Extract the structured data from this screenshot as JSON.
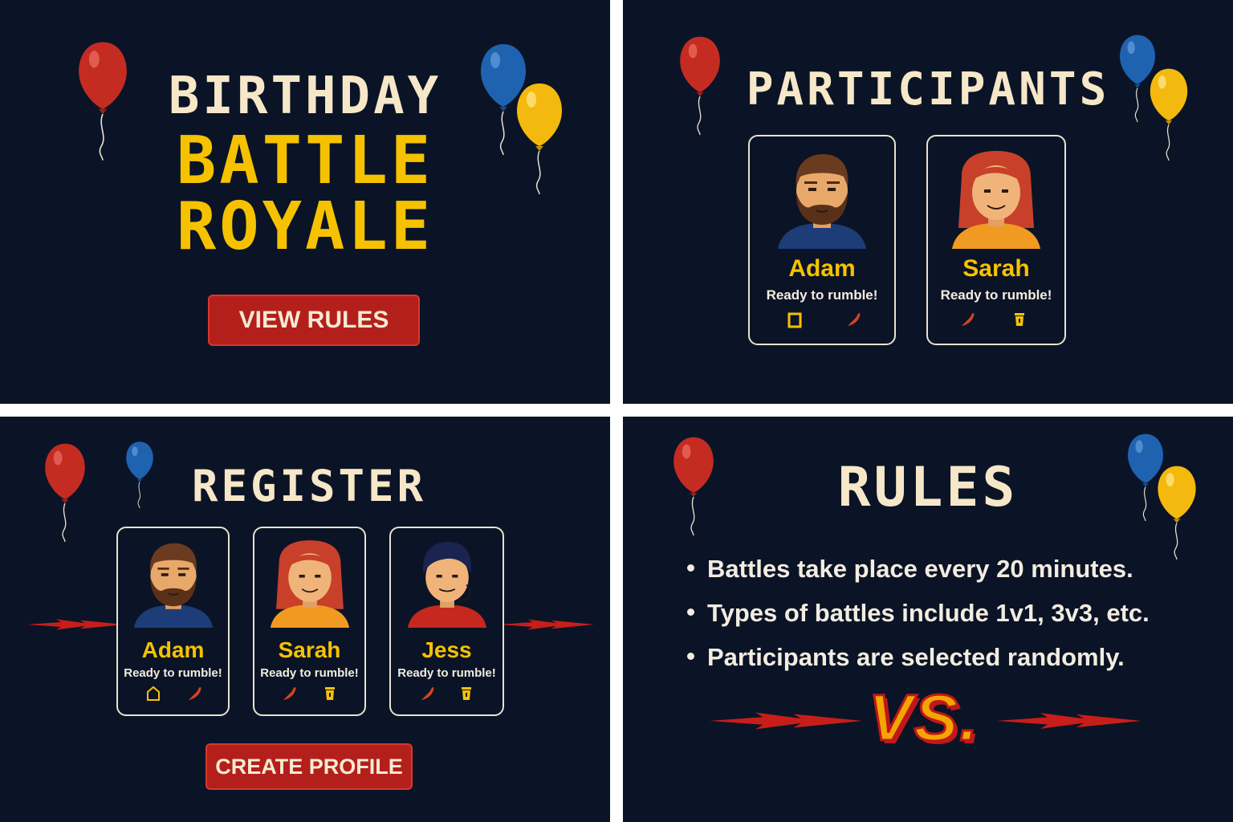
{
  "colors": {
    "panel_bg": "#0b1426",
    "title_cream": "#f6e7c8",
    "title_yellow": "#f6c200",
    "button_red": "#b3201b",
    "balloon_red": "#c42c22",
    "balloon_blue": "#1f62b0",
    "balloon_yellow": "#f4b90e"
  },
  "home": {
    "title_line1": "BIRTHDAY",
    "title_line2": "BATTLE",
    "title_line3": "ROYALE",
    "button_label": "VIEW RULES",
    "balloons": [
      "red",
      "blue",
      "yellow"
    ]
  },
  "participants": {
    "title": "PARTICIPANTS",
    "cards": [
      {
        "name": "Adam",
        "status": "Ready to rumble!",
        "icons": [
          "square-icon",
          "pepper-icon"
        ]
      },
      {
        "name": "Sarah",
        "status": "Ready to rumble!",
        "icons": [
          "pepper-icon",
          "cup-icon"
        ]
      }
    ],
    "balloons": [
      "red",
      "blue",
      "yellow"
    ]
  },
  "register": {
    "title": "REGISTER",
    "cards": [
      {
        "name": "Adam",
        "status": "Ready to rumble!",
        "icons": [
          "house-icon",
          "pepper-icon"
        ]
      },
      {
        "name": "Sarah",
        "status": "Ready to rumble!",
        "icons": [
          "pepper-icon",
          "cup-icon"
        ]
      },
      {
        "name": "Jess",
        "status": "Ready to rumble!",
        "icons": [
          "pepper-icon",
          "cup-icon"
        ]
      }
    ],
    "button_label": "CREATE PROFILE",
    "balloons": [
      "red",
      "blue"
    ]
  },
  "rules": {
    "title": "RULES",
    "items": [
      "Battles take place every 20 minutes.",
      "Types of battles include 1v1, 3v3, etc.",
      "Participants are selected randomly."
    ],
    "vs_label": "VS.",
    "balloons": [
      "red",
      "blue",
      "yellow"
    ]
  }
}
